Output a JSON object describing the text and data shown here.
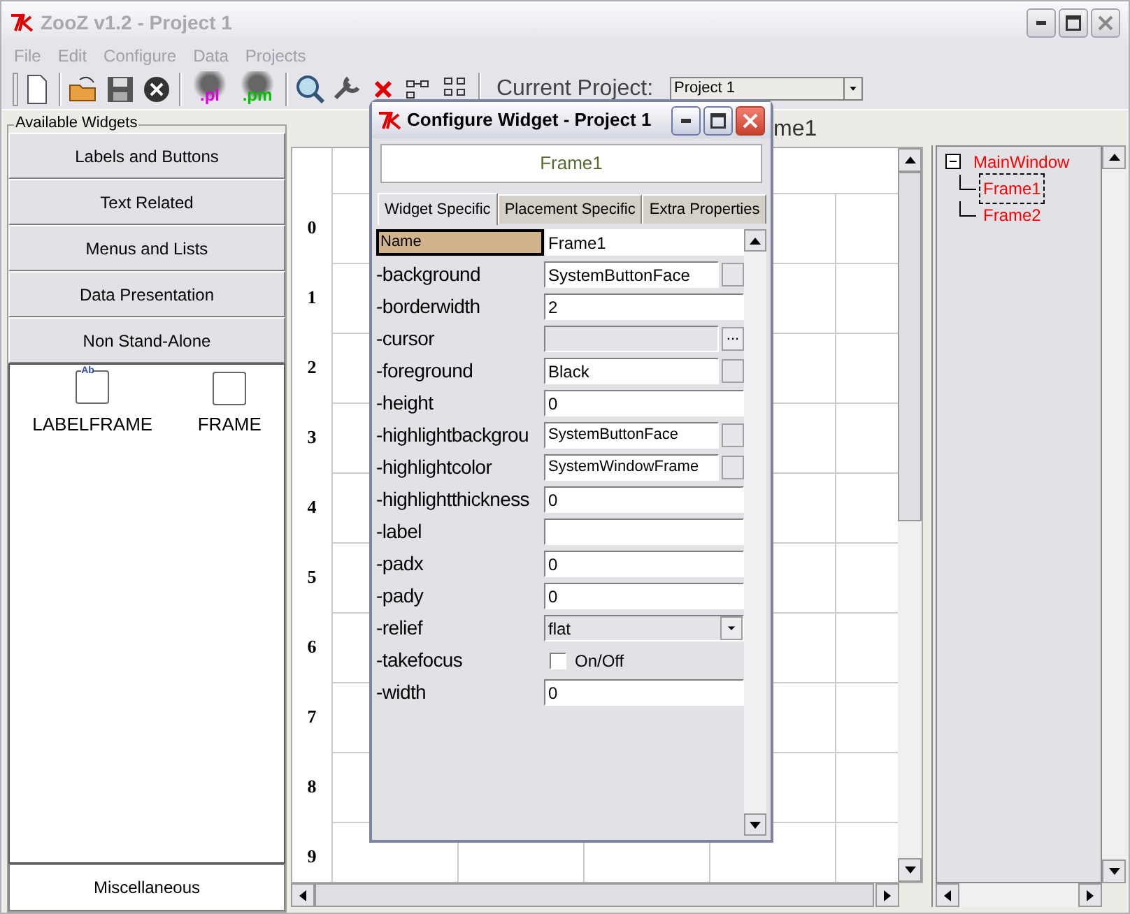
{
  "window": {
    "title": "ZooZ v1.2 - Project 1"
  },
  "menu": [
    "File",
    "Edit",
    "Configure",
    "Data",
    "Projects"
  ],
  "toolbar": {
    "script_buttons": [
      ".pl",
      ".pm"
    ],
    "project_label": "Current Project:",
    "project_value": "Project 1"
  },
  "sidebar": {
    "title": "Available Widgets",
    "categories": [
      "Labels and Buttons",
      "Text Related",
      "Menus and Lists",
      "Data Presentation",
      "Non Stand-Alone"
    ],
    "widgets": [
      {
        "kind": "labelframe",
        "label": "LABELFRAME",
        "icon_text": "Ab"
      },
      {
        "kind": "frame",
        "label": "FRAME"
      }
    ],
    "bottom": "Miscellaneous"
  },
  "canvas": {
    "title": "me1",
    "row_numbers": [
      "0",
      "1",
      "2",
      "3",
      "4",
      "5",
      "6",
      "7",
      "8",
      "9"
    ]
  },
  "tree": [
    {
      "label": "MainWindow",
      "expanded": true,
      "selected": false,
      "children": [
        {
          "label": "Frame1",
          "selected": true
        },
        {
          "label": "Frame2",
          "selected": false
        }
      ]
    }
  ],
  "dialog": {
    "title": "Configure Widget - Project 1",
    "widget_name": "Frame1",
    "tabs": [
      {
        "label": "Widget Specific",
        "selected": true
      },
      {
        "label": "Placement Specific",
        "selected": false
      },
      {
        "label": "Extra Properties",
        "selected": false
      }
    ],
    "header": {
      "label": "Name",
      "value": "Frame1"
    },
    "properties": [
      {
        "kind": "color",
        "label": "-background",
        "value": "SystemButtonFace"
      },
      {
        "kind": "text",
        "label": "-borderwidth",
        "value": "2"
      },
      {
        "kind": "browse",
        "label": "-cursor",
        "button": "..."
      },
      {
        "kind": "color",
        "label": "-foreground",
        "value": "Black"
      },
      {
        "kind": "text",
        "label": "-height",
        "value": "0"
      },
      {
        "kind": "color",
        "label": "-highlightbackgrou",
        "value": "SystemButtonFace",
        "small": true
      },
      {
        "kind": "color",
        "label": "-highlightcolor",
        "value": "SystemWindowFrame",
        "small": true
      },
      {
        "kind": "text",
        "label": "-highlightthickness",
        "value": "0"
      },
      {
        "kind": "text",
        "label": "-label"
      },
      {
        "kind": "text",
        "label": "-padx",
        "value": "0"
      },
      {
        "kind": "text",
        "label": "-pady",
        "value": "0"
      },
      {
        "kind": "select",
        "label": "-relief",
        "value": "flat"
      },
      {
        "kind": "check",
        "label": "-takefocus",
        "text": "On/Off",
        "checked": false
      },
      {
        "kind": "text",
        "label": "-width",
        "value": "0"
      }
    ]
  }
}
